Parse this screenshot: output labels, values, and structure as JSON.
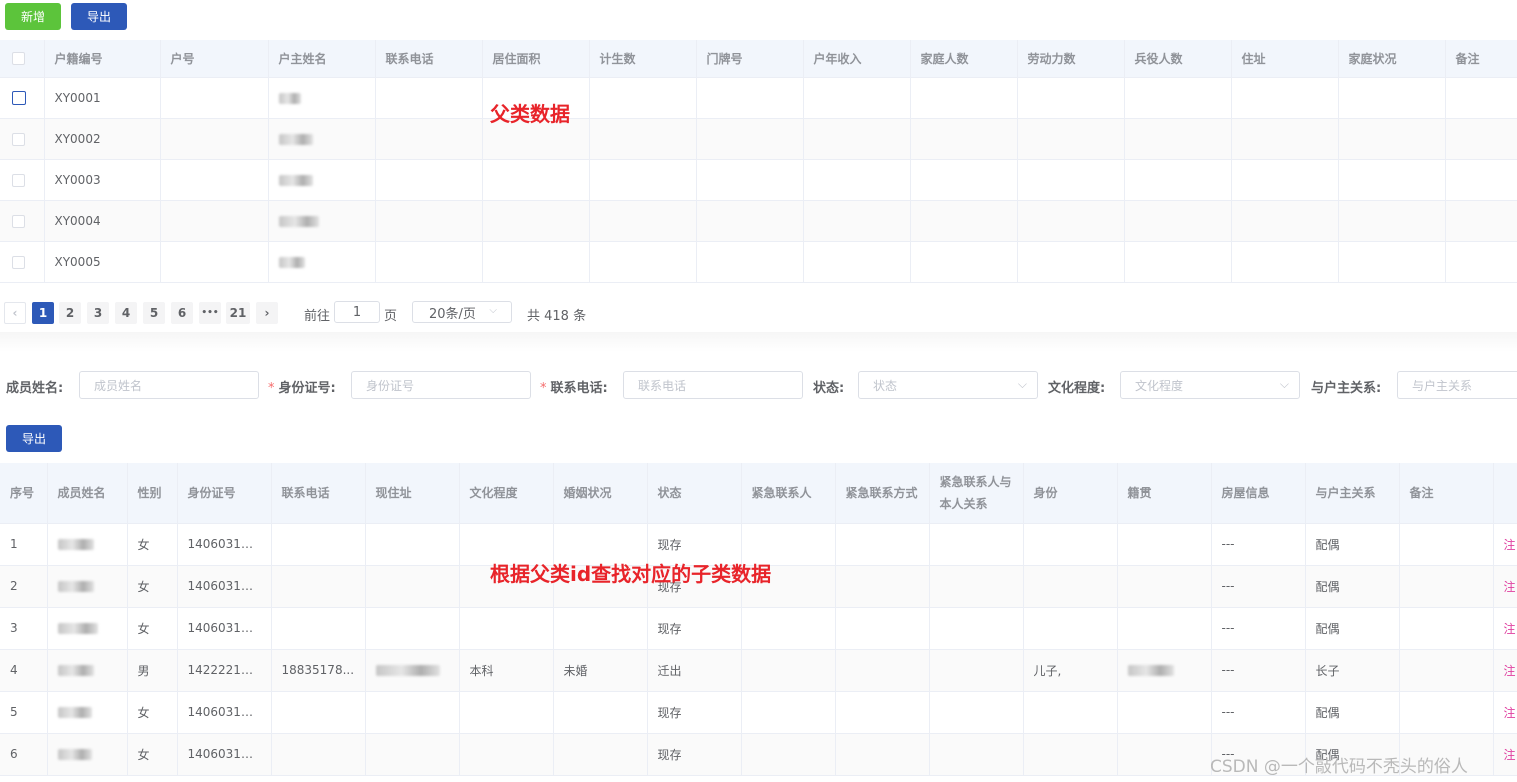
{
  "toolbar": {
    "add_label": "新增",
    "export_label": "导出"
  },
  "parent_table": {
    "columns": [
      "户籍编号",
      "户号",
      "户主姓名",
      "联系电话",
      "居住面积",
      "计生数",
      "门牌号",
      "户年收入",
      "家庭人数",
      "劳动力数",
      "兵役人数",
      "住址",
      "家庭状况",
      "备注"
    ],
    "rows": [
      {
        "code": "XY0001"
      },
      {
        "code": "XY0002"
      },
      {
        "code": "XY0003"
      },
      {
        "code": "XY0004"
      },
      {
        "code": "XY0005"
      }
    ]
  },
  "pagination": {
    "prev": "‹",
    "pages": [
      "1",
      "2",
      "3",
      "4",
      "5",
      "6",
      "•••",
      "21"
    ],
    "next": "›",
    "goto_prefix": "前往",
    "goto_value": "1",
    "goto_suffix": "页",
    "page_size": "20条/页",
    "total": "共 418 条"
  },
  "filters": {
    "name_label": "成员姓名:",
    "name_placeholder": "成员姓名",
    "id_label": "身份证号:",
    "id_placeholder": "身份证号",
    "phone_label": "联系电话:",
    "phone_placeholder": "联系电话",
    "status_label": "状态:",
    "status_placeholder": "状态",
    "edu_label": "文化程度:",
    "edu_placeholder": "文化程度",
    "relation_label": "与户主关系:",
    "relation_placeholder": "与户主关系",
    "required_mark": "*"
  },
  "member_toolbar": {
    "export_label": "导出"
  },
  "child_table": {
    "columns": [
      "序号",
      "成员姓名",
      "性别",
      "身份证号",
      "联系电话",
      "现住址",
      "文化程度",
      "婚姻状况",
      "状态",
      "紧急联系人",
      "紧急联系方式",
      "紧急联系人与本人关系",
      "身份",
      "籍贯",
      "房屋信息",
      "与户主关系",
      "备注"
    ],
    "rows": [
      {
        "index": "1",
        "gender": "女",
        "id_no": "14060319*...",
        "phone": "",
        "edu": "",
        "marital": "",
        "status": "现存",
        "identity": "",
        "house": "---",
        "relation": "配偶",
        "op": "注"
      },
      {
        "index": "2",
        "gender": "女",
        "id_no": "14060319*...",
        "phone": "",
        "edu": "",
        "marital": "",
        "status": "现存",
        "identity": "",
        "house": "---",
        "relation": "配偶",
        "op": "注"
      },
      {
        "index": "3",
        "gender": "女",
        "id_no": "14060319*...",
        "phone": "",
        "edu": "",
        "marital": "",
        "status": "现存",
        "identity": "",
        "house": "---",
        "relation": "配偶",
        "op": "注"
      },
      {
        "index": "4",
        "gender": "男",
        "id_no": "14222219*...",
        "phone": "18835178...",
        "edu": "本科",
        "marital": "未婚",
        "status": "迁出",
        "identity": "儿子,",
        "house": "---",
        "relation": "长子",
        "op": "注"
      },
      {
        "index": "5",
        "gender": "女",
        "id_no": "14060319*...",
        "phone": "",
        "edu": "",
        "marital": "",
        "status": "现存",
        "identity": "",
        "house": "---",
        "relation": "配偶",
        "op": "注"
      },
      {
        "index": "6",
        "gender": "女",
        "id_no": "14060319*...",
        "phone": "",
        "edu": "",
        "marital": "",
        "status": "现存",
        "identity": "",
        "house": "---",
        "relation": "配偶",
        "op": "注"
      }
    ]
  },
  "annotations": {
    "parent": "父类数据",
    "child": "根据父类id查找对应的子类数据"
  },
  "watermark": "CSDN @一个敲代码不秃头的俗人",
  "colors": {
    "primary": "#2d59b8",
    "success": "#5cc43b",
    "annotation": "#e8242a",
    "link": "#e040a0"
  }
}
